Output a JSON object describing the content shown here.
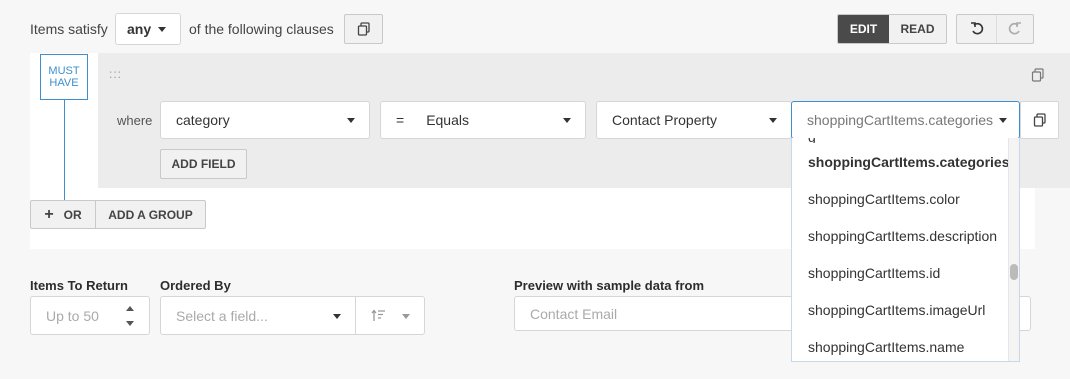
{
  "header": {
    "items_satisfy_label": "Items satisfy",
    "satisfy_value": "any",
    "following_clauses_label": "of the following clauses",
    "edit_label": "EDIT",
    "read_label": "READ"
  },
  "clause": {
    "must_have_label": "MUST\nHAVE",
    "drag_handle": ":::",
    "where_label": "where",
    "field_value": "category",
    "operator_symbol": "=",
    "operator_label": "Equals",
    "source_value": "Contact Property",
    "property_value": "shoppingCartItems.categories",
    "add_field_label": "ADD FIELD"
  },
  "group_actions": {
    "or_label": "OR",
    "add_group_label": "ADD A GROUP"
  },
  "dropdown": {
    "partial_item": "g",
    "items": [
      {
        "label": "shoppingCartItems.categories",
        "selected": true
      },
      {
        "label": "shoppingCartItems.color",
        "selected": false
      },
      {
        "label": "shoppingCartItems.description",
        "selected": false
      },
      {
        "label": "shoppingCartItems.id",
        "selected": false
      },
      {
        "label": "shoppingCartItems.imageUrl",
        "selected": false
      },
      {
        "label": "shoppingCartItems.name",
        "selected": false
      }
    ]
  },
  "bottom": {
    "items_to_return_label": "Items To Return",
    "items_to_return_placeholder": "Up to 50",
    "ordered_by_label": "Ordered By",
    "ordered_by_placeholder": "Select a field...",
    "preview_label": "Preview with sample data from",
    "preview_placeholder": "Contact Email"
  },
  "colors": {
    "accent_blue": "#3d8fcf",
    "dark_button": "#4a4a4a",
    "panel_gray": "#ececed"
  }
}
